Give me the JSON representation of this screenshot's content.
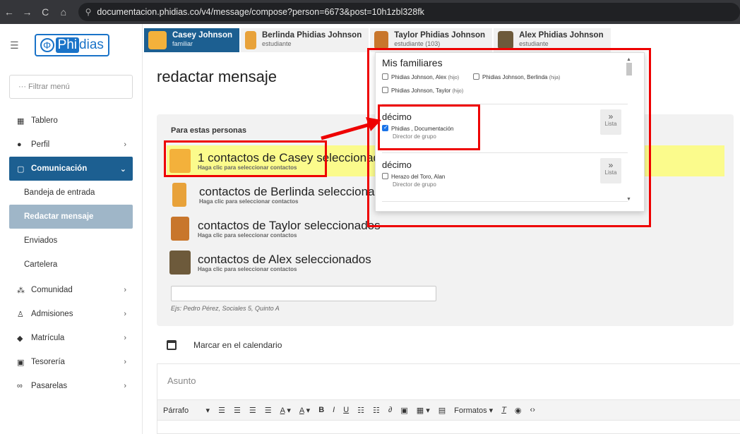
{
  "browser": {
    "url": "documentacion.phidias.co/v4/message/compose?person=6673&post=10h1zbl328fk",
    "nav": [
      "←",
      "→",
      "C",
      "⌂"
    ]
  },
  "sidebar": {
    "filter_placeholder": "··· Filtrar menú",
    "logo_a": "Phi",
    "logo_b": "dias",
    "items": [
      {
        "label": "Tablero",
        "icon": "dashboard-icon"
      },
      {
        "label": "Perfil",
        "icon": "user-icon"
      },
      {
        "label": "Comunicación",
        "icon": "chat-icon"
      },
      {
        "label": "Comunidad",
        "icon": "community-icon"
      },
      {
        "label": "Admisiones",
        "icon": "admissions-icon"
      },
      {
        "label": "Matrícula",
        "icon": "graduation-icon"
      },
      {
        "label": "Tesorería",
        "icon": "money-icon"
      },
      {
        "label": "Pasarelas",
        "icon": "link-icon"
      }
    ],
    "sub": [
      "Bandeja de entrada",
      "Redactar mensaje",
      "Enviados",
      "Cartelera"
    ]
  },
  "tabs": [
    {
      "name": "Casey Johnson",
      "role": "familiar",
      "color": "#f3b13b"
    },
    {
      "name": "Berlinda Phidias Johnson",
      "role": "estudiante",
      "color": "#e8a23a"
    },
    {
      "name": "Taylor Phidias Johnson",
      "role": "estudiante (103)",
      "color": "#c8762c"
    },
    {
      "name": "Alex Phidias Johnson",
      "role": "estudiante",
      "color": "#6d5a3b"
    }
  ],
  "title": "redactar mensaje",
  "card": {
    "label": "Para estas personas",
    "rows": [
      {
        "text": "1 contactos de Casey seleccionados",
        "hint": "Haga clic para seleccionar contactos"
      },
      {
        "text": "contactos de Berlinda seleccionados",
        "hint": "Haga clic para seleccionar contactos"
      },
      {
        "text": "contactos de Taylor seleccionados",
        "hint": "Haga clic para seleccionar contactos"
      },
      {
        "text": "contactos de Alex seleccionados",
        "hint": "Haga clic para seleccionar contactos"
      }
    ],
    "example": "Ejs: Pedro Pérez, Sociales 5, Quinto A"
  },
  "calendar": "Marcar en el calendario",
  "subject_label": "Asunto",
  "editor": {
    "format": "Párrafo",
    "formats": "Formatos"
  },
  "popup": {
    "family_title": "Mis familiares",
    "family": [
      {
        "name": "Phidias Johnson, Alex",
        "rel": "(hijo)"
      },
      {
        "name": "Phidias Johnson, Berlinda",
        "rel": "(hija)"
      },
      {
        "name": "Phidias Johnson, Taylor",
        "rel": "(hijo)"
      }
    ],
    "groups": [
      {
        "title": "décimo",
        "person": "Phidias , Documentación",
        "role": "Director de grupo",
        "checked": true
      },
      {
        "title": "décimo",
        "person": "Herazo del Toro, Alan",
        "role": "Director de grupo",
        "checked": false
      }
    ],
    "list_arrow": "»",
    "list_label": "Lista"
  }
}
